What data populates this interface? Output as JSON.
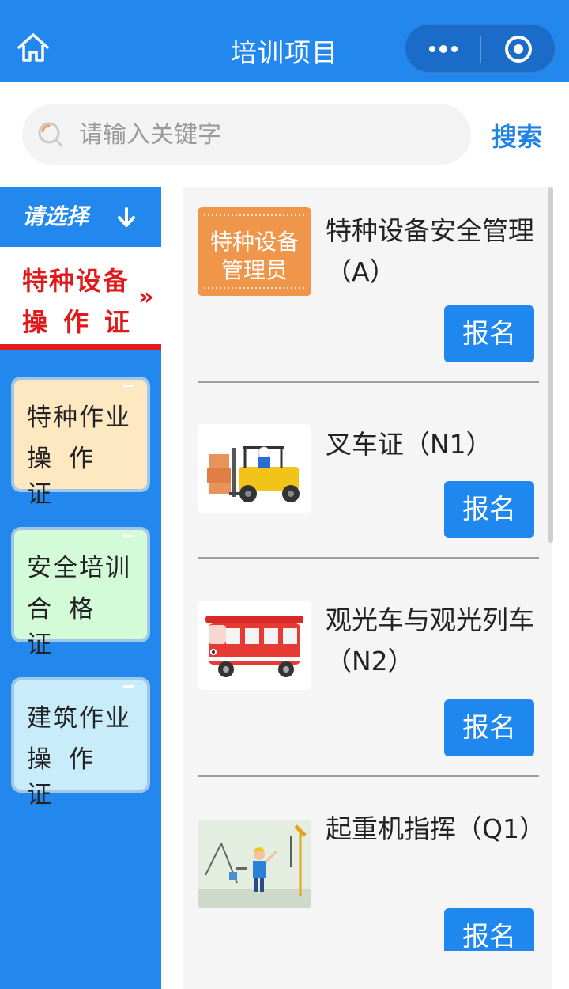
{
  "header": {
    "title": "培训项目"
  },
  "search": {
    "placeholder": "请输入关键字",
    "button_label": "搜索"
  },
  "sidebar": {
    "heading": "请选择",
    "active": {
      "line1": "特种设备",
      "line2": "操作证",
      "chevron": "»"
    },
    "categories": [
      {
        "line1": "特种作业",
        "line2": "操作证",
        "bg": "#fde8c2"
      },
      {
        "line1": "安全培训",
        "line2": "合格证",
        "bg": "#d4fbd8"
      },
      {
        "line1": "建筑作业",
        "line2": "操作证",
        "bg": "#c9ecfb"
      }
    ]
  },
  "items": [
    {
      "name": "特种设备安全管理（A）",
      "thumb_text_1": "特种设备",
      "thumb_text_2": "管理员",
      "button": "报名"
    },
    {
      "name": "叉车证（N1）",
      "button": "报名"
    },
    {
      "name": "观光车与观光列车（N2）",
      "button": "报名"
    },
    {
      "name": "起重机指挥（Q1）",
      "button": "报名"
    }
  ],
  "colors": {
    "primary": "#2288ee",
    "active_red": "#e01a1a",
    "button": "#1e88ee"
  }
}
